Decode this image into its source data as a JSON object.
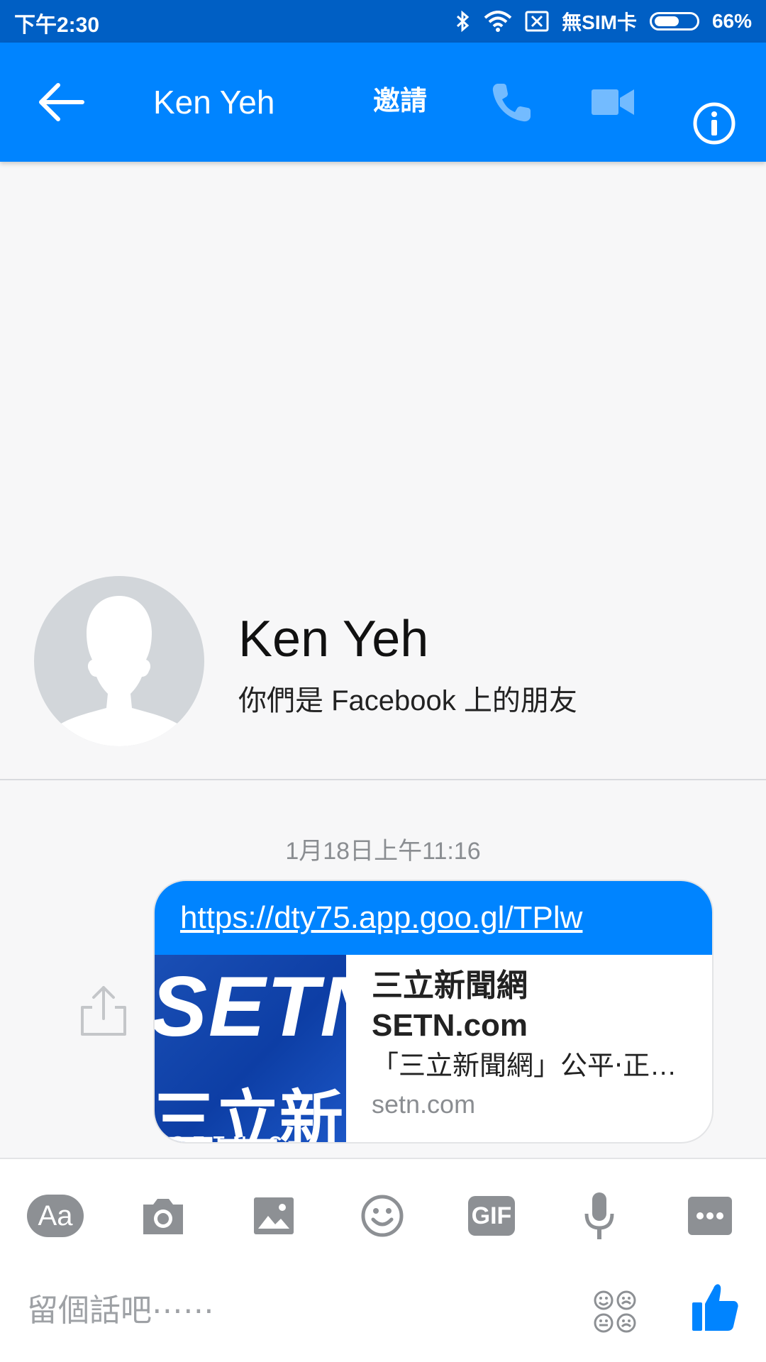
{
  "status_bar": {
    "time": "下午2:30",
    "sim": "無SIM卡",
    "battery_percent": "66%",
    "battery_level": 0.66
  },
  "app_bar": {
    "title": "Ken Yeh",
    "invite_label": "邀請",
    "icons": [
      "back-arrow-icon",
      "phone-icon",
      "video-camera-icon",
      "info-icon"
    ]
  },
  "profile": {
    "name": "Ken Yeh",
    "subtitle": "你們是 Facebook 上的朋友"
  },
  "conversation": {
    "timestamp": "1月18日上午11:16",
    "message": {
      "link": "https://dty75.app.goo.gl/TPlw",
      "preview_title_line1": "三立新聞網",
      "preview_title_line2": "SETN.com",
      "preview_description": "「三立新聞網」公平‧正確‧多元",
      "preview_domain": "setn.com",
      "thumbnail_text": "SETN",
      "thumbnail_subtext": "三立新聞",
      "thumbnail_strip": "SETN.C"
    }
  },
  "composer": {
    "aa_label": "Aa",
    "gif_label": "GIF",
    "placeholder": "留個話吧⋯⋯",
    "tools": [
      "text-style-icon",
      "camera-icon",
      "image-icon",
      "emoji-icon",
      "gif-icon",
      "microphone-icon",
      "more-icon"
    ]
  },
  "colors": {
    "status_bar": "#005fc4",
    "app_bar": "#0084ff",
    "accent": "#0084ff",
    "tool_gray": "#8d9094"
  }
}
